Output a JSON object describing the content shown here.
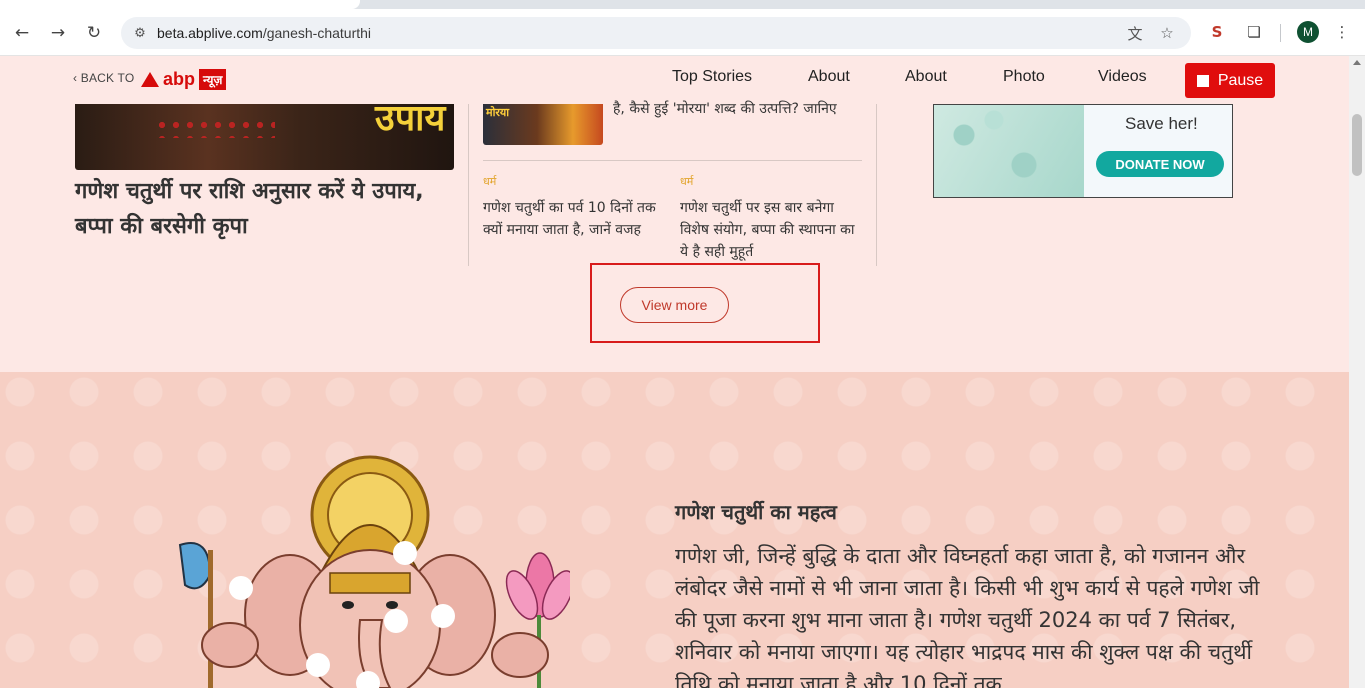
{
  "browser": {
    "url_domain": "beta.abplive.com",
    "url_path": "/ganesh-chaturthi",
    "profile_initial": "M"
  },
  "header": {
    "back_to": "BACK TO",
    "logo_text": "abp",
    "logo_tag": "न्यूज़",
    "nav": [
      "Top Stories",
      "About",
      "About",
      "Photo",
      "Videos"
    ],
    "pause_label": "Pause"
  },
  "stories": {
    "hero_title": "गणेश चतुर्थी पर राशि अनुसार करें ये उपाय, बप्पा की बरसेगी कृपा",
    "hero_overlay": "उपाय",
    "top_story_thumb_tag": "मोरया",
    "top_story_text": "है, कैसे हुई 'मोरया' शब्द की उत्पत्ति? जानिए",
    "left_category": "धर्म",
    "left_story": "गणेश चतुर्थी का पर्व 10 दिनों तक क्यों मनाया जाता है, जानें वजह",
    "right_category": "धर्म",
    "right_story": "गणेश चतुर्थी पर इस बार बनेगा विशेष संयोग, बप्पा की स्थापना का ये है सही मुहूर्त",
    "view_more": "View more"
  },
  "ad": {
    "text": "Save her!",
    "cta": "DONATE NOW"
  },
  "significance": {
    "title": "गणेश चतुर्थी का महत्व",
    "body": "गणेश जी, जिन्हें बुद्धि के दाता और विघ्नहर्ता कहा जाता है, को गजानन और लंबोदर जैसे नामों से भी जाना जाता है। किसी भी शुभ कार्य से पहले गणेश जी की पूजा करना शुभ माना जाता है। गणेश चतुर्थी 2024 का पर्व 7 सितंबर, शनिवार को मनाया जाएगा। यह त्योहार भाद्रपद मास की शुक्ल पक्ष की चतुर्थी तिथि को मनाया जाता है और 10 दिनों तक"
  },
  "colors": {
    "brand_red": "#d60b0b",
    "page_bg": "#fde8e5",
    "section_bg": "#f6cfc4",
    "category": "#e2a42b"
  }
}
